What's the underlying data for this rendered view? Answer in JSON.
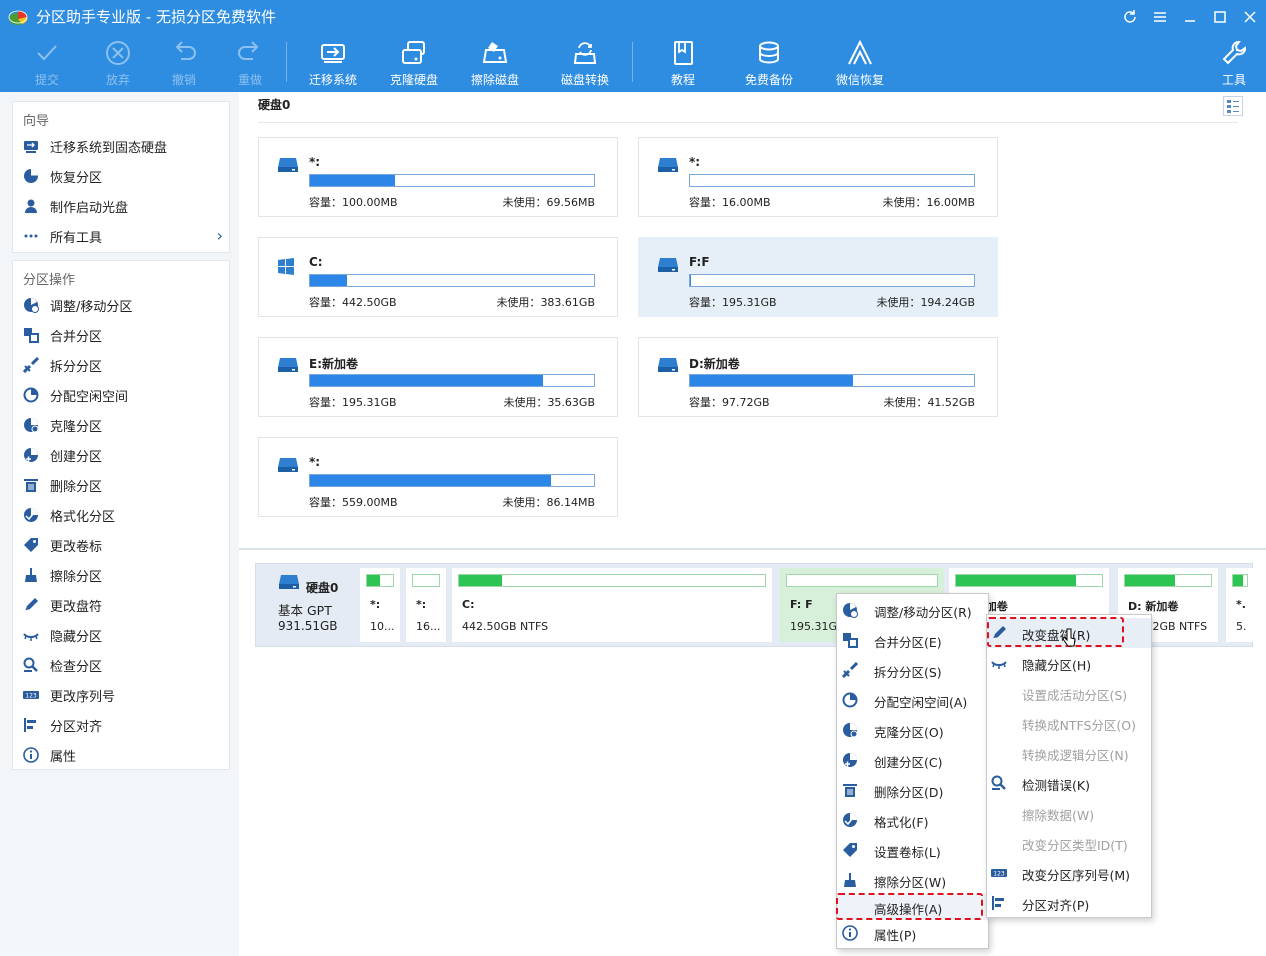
{
  "app": {
    "title": "分区助手专业版 - 无损分区免费软件"
  },
  "toolbar": {
    "items": [
      {
        "label": "提交",
        "icon": "check-icon",
        "enabled": false
      },
      {
        "label": "放弃",
        "icon": "cancel-circle-icon",
        "enabled": false
      },
      {
        "label": "撤销",
        "icon": "undo-icon",
        "enabled": false
      },
      {
        "label": "重做",
        "icon": "redo-icon",
        "enabled": false
      },
      {
        "label": "迁移系统",
        "icon": "migrate-system-icon",
        "enabled": true
      },
      {
        "label": "克隆硬盘",
        "icon": "clone-disk-icon",
        "enabled": true
      },
      {
        "label": "擦除磁盘",
        "icon": "wipe-disk-icon",
        "enabled": true
      },
      {
        "label": "磁盘转换",
        "icon": "disk-convert-icon",
        "enabled": true
      },
      {
        "label": "教程",
        "icon": "tutorial-book-icon",
        "enabled": true
      },
      {
        "label": "免费备份",
        "icon": "free-backup-icon",
        "enabled": true
      },
      {
        "label": "微信恢复",
        "icon": "wechat-recovery-icon",
        "enabled": true
      },
      {
        "label": "工具",
        "icon": "wrench-tools-icon",
        "enabled": true
      }
    ]
  },
  "sidebar": {
    "wizard_title": "向导",
    "wizard_items": [
      {
        "label": "迁移系统到固态硬盘",
        "icon": "migrate-ssd-icon"
      },
      {
        "label": "恢复分区",
        "icon": "recover-partition-icon"
      },
      {
        "label": "制作启动光盘",
        "icon": "bootable-media-icon"
      },
      {
        "label": "所有工具",
        "icon": "all-tools-icon",
        "chevron": "›"
      }
    ],
    "ops_title": "分区操作",
    "ops_items": [
      {
        "label": "调整/移动分区",
        "icon": "resize-icon"
      },
      {
        "label": "合并分区",
        "icon": "merge-icon"
      },
      {
        "label": "拆分分区",
        "icon": "split-icon"
      },
      {
        "label": "分配空闲空间",
        "icon": "allocate-space-icon"
      },
      {
        "label": "克隆分区",
        "icon": "clone-partition-icon"
      },
      {
        "label": "创建分区",
        "icon": "create-partition-icon"
      },
      {
        "label": "删除分区",
        "icon": "delete-partition-icon"
      },
      {
        "label": "格式化分区",
        "icon": "format-icon"
      },
      {
        "label": "更改卷标",
        "icon": "label-tag-icon"
      },
      {
        "label": "擦除分区",
        "icon": "wipe-brush-icon"
      },
      {
        "label": "更改盘符",
        "icon": "change-letter-icon"
      },
      {
        "label": "隐藏分区",
        "icon": "hide-eye-icon"
      },
      {
        "label": "检查分区",
        "icon": "check-partition-icon"
      },
      {
        "label": "更改序列号",
        "icon": "serial-number-icon"
      },
      {
        "label": "分区对齐",
        "icon": "align-icon"
      },
      {
        "label": "属性",
        "icon": "info-icon"
      }
    ]
  },
  "main": {
    "disk_title": "硬盘0",
    "cap_prefix": "容量：",
    "free_prefix": "未使用：",
    "partitions": [
      {
        "name": "*:",
        "os": "drive",
        "capacity": "100.00MB",
        "free": "69.56MB",
        "used_frac": 0.3,
        "selected": false
      },
      {
        "name": "*:",
        "os": "drive",
        "capacity": "16.00MB",
        "free": "16.00MB",
        "used_frac": 0.0,
        "selected": false
      },
      {
        "name": "C:",
        "os": "windows",
        "capacity": "442.50GB",
        "free": "383.61GB",
        "used_frac": 0.13,
        "selected": false
      },
      {
        "name": "F:F",
        "os": "drive",
        "capacity": "195.31GB",
        "free": "194.24GB",
        "used_frac": 0.005,
        "selected": true
      },
      {
        "name": "E:新加卷",
        "os": "drive",
        "capacity": "195.31GB",
        "free": "35.63GB",
        "used_frac": 0.82,
        "selected": false
      },
      {
        "name": "D:新加卷",
        "os": "drive",
        "capacity": "97.72GB",
        "free": "41.52GB",
        "used_frac": 0.575,
        "selected": false
      },
      {
        "name": "*:",
        "os": "drive",
        "capacity": "559.00MB",
        "free": "86.14MB",
        "used_frac": 0.85,
        "selected": false
      }
    ]
  },
  "diskmap": {
    "disk_name": "硬盘0",
    "disk_type": "基本 GPT",
    "disk_size": "931.51GB",
    "segments": [
      {
        "label": "*:",
        "info": "10...",
        "used_frac": 0.5
      },
      {
        "label": "*:",
        "info": "16...",
        "used_frac": 0.0
      },
      {
        "label": "C:",
        "info": "442.50GB NTFS",
        "used_frac": 0.14
      },
      {
        "label": "F: F",
        "info": "195.31GB",
        "used_frac": 0.0
      },
      {
        "label": "E: 新加卷",
        "info": "",
        "used_frac": 0.82
      },
      {
        "label": "D: 新加卷",
        "info": "97.72GB NTFS",
        "used_frac": 0.58
      },
      {
        "label": "*.",
        "info": "5.",
        "used_frac": 0.7
      }
    ]
  },
  "context_menu": {
    "items": [
      {
        "label": "调整/移动分区(R)",
        "icon": "resize-icon"
      },
      {
        "label": "合并分区(E)",
        "icon": "merge-icon"
      },
      {
        "label": "拆分分区(S)",
        "icon": "split-icon"
      },
      {
        "label": "分配空闲空间(A)",
        "icon": "allocate-space-icon"
      },
      {
        "label": "克隆分区(O)",
        "icon": "clone-partition-icon"
      },
      {
        "label": "创建分区(C)",
        "icon": "create-partition-icon"
      },
      {
        "label": "删除分区(D)",
        "icon": "delete-partition-icon"
      },
      {
        "label": "格式化(F)",
        "icon": "format-icon"
      },
      {
        "label": "设置卷标(L)",
        "icon": "label-tag-icon"
      },
      {
        "label": "擦除分区(W)",
        "icon": "wipe-brush-icon"
      },
      {
        "label": "高级操作(A)",
        "icon": "",
        "highlighted": true
      },
      {
        "label": "属性(P)",
        "icon": "info-icon"
      }
    ]
  },
  "submenu": {
    "items": [
      {
        "label": "改变盘符(R)",
        "icon": "change-letter-icon",
        "enabled": true,
        "highlighted": true
      },
      {
        "label": "隐藏分区(H)",
        "icon": "hide-eye-icon",
        "enabled": true
      },
      {
        "label": "设置成活动分区(S)",
        "icon": "",
        "enabled": false
      },
      {
        "label": "转换成NTFS分区(O)",
        "icon": "",
        "enabled": false
      },
      {
        "label": "转换成逻辑分区(N)",
        "icon": "",
        "enabled": false
      },
      {
        "label": "检测错误(K)",
        "icon": "check-partition-icon",
        "enabled": true
      },
      {
        "label": "擦除数据(W)",
        "icon": "",
        "enabled": false
      },
      {
        "label": "改变分区类型ID(T)",
        "icon": "",
        "enabled": false
      },
      {
        "label": "改变分区序列号(M)",
        "icon": "serial-number-icon",
        "enabled": true
      },
      {
        "label": "分区对齐(P)",
        "icon": "align-icon",
        "enabled": true
      }
    ]
  },
  "colors": {
    "accent": "#2e8de1",
    "bar_blue": "#2c86e8",
    "bar_green": "#2ec454",
    "highlight_red": "#e0101e"
  }
}
